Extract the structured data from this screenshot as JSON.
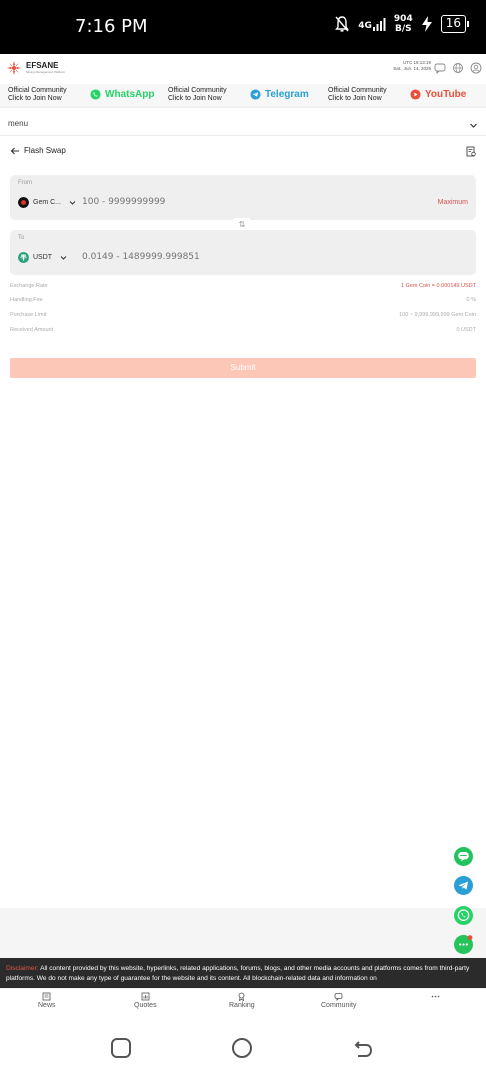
{
  "statusbar": {
    "time": "7:16 PM",
    "network": "4G",
    "speed_value": "904",
    "speed_unit": "B/S",
    "battery": "16"
  },
  "header": {
    "logo_text": "EFSANE",
    "logo_sub": "Mining Management Platform",
    "utc_line1": "UTC 19:13:19",
    "utc_line2": "Sat., Jun. 14, 2025"
  },
  "banner": {
    "item1": {
      "line1": "Official Community",
      "line2": "Click to Join Now",
      "button": "WhatsApp",
      "color": "#25d366"
    },
    "item2": {
      "line1": "Official Community",
      "line2": "Click to Join Now",
      "button": "Telegram",
      "color": "#2a9fd6"
    },
    "item3": {
      "line1": "Official Community",
      "line2": "Click to Join Now",
      "button": "YouTube",
      "color": "#e8503a"
    }
  },
  "menu": {
    "label": "menu"
  },
  "page": {
    "title": "Flash Swap"
  },
  "from": {
    "label": "From",
    "coin": "Gem C...",
    "placeholder": "100 - 9999999999",
    "max": "Maximum"
  },
  "switch_symbol": "⇅",
  "to": {
    "label": "To",
    "coin": "USDT",
    "placeholder": "0.0149 - 1489999.999851"
  },
  "info": [
    {
      "key": "Exchange Rate",
      "value": "1 Gem Coin = 0.000149 USDT",
      "highlight": true
    },
    {
      "key": "Handling Fee",
      "value": "0 %",
      "highlight": false
    },
    {
      "key": "Purchase Limit",
      "value": "100 ~ 9,999,999,999 Gem Coin",
      "highlight": false
    },
    {
      "key": "Received Amount",
      "value": "0 USDT",
      "highlight": false
    }
  ],
  "submit": {
    "label": "Submit"
  },
  "disclaimer": {
    "label": "Disclaimer:",
    "text": "All content provided by this website, hyperlinks, related applications, forums, blogs, and other media accounts and platforms comes from third-party platforms. We do not make any type of guarantee for the website and its content. All blockchain-related data and information on"
  },
  "tabs": [
    {
      "label": "News",
      "icon": "news-icon"
    },
    {
      "label": "Quotes",
      "icon": "quotes-icon"
    },
    {
      "label": "Ranking",
      "icon": "ranking-icon"
    },
    {
      "label": "Community",
      "icon": "community-icon"
    },
    {
      "label": "",
      "icon": "more-icon"
    }
  ],
  "colors": {
    "accent": "#e8503a",
    "submit_disabled": "#fdc7b8",
    "box_bg": "#efefef",
    "disclaimer_bg": "#2b2b2b"
  }
}
